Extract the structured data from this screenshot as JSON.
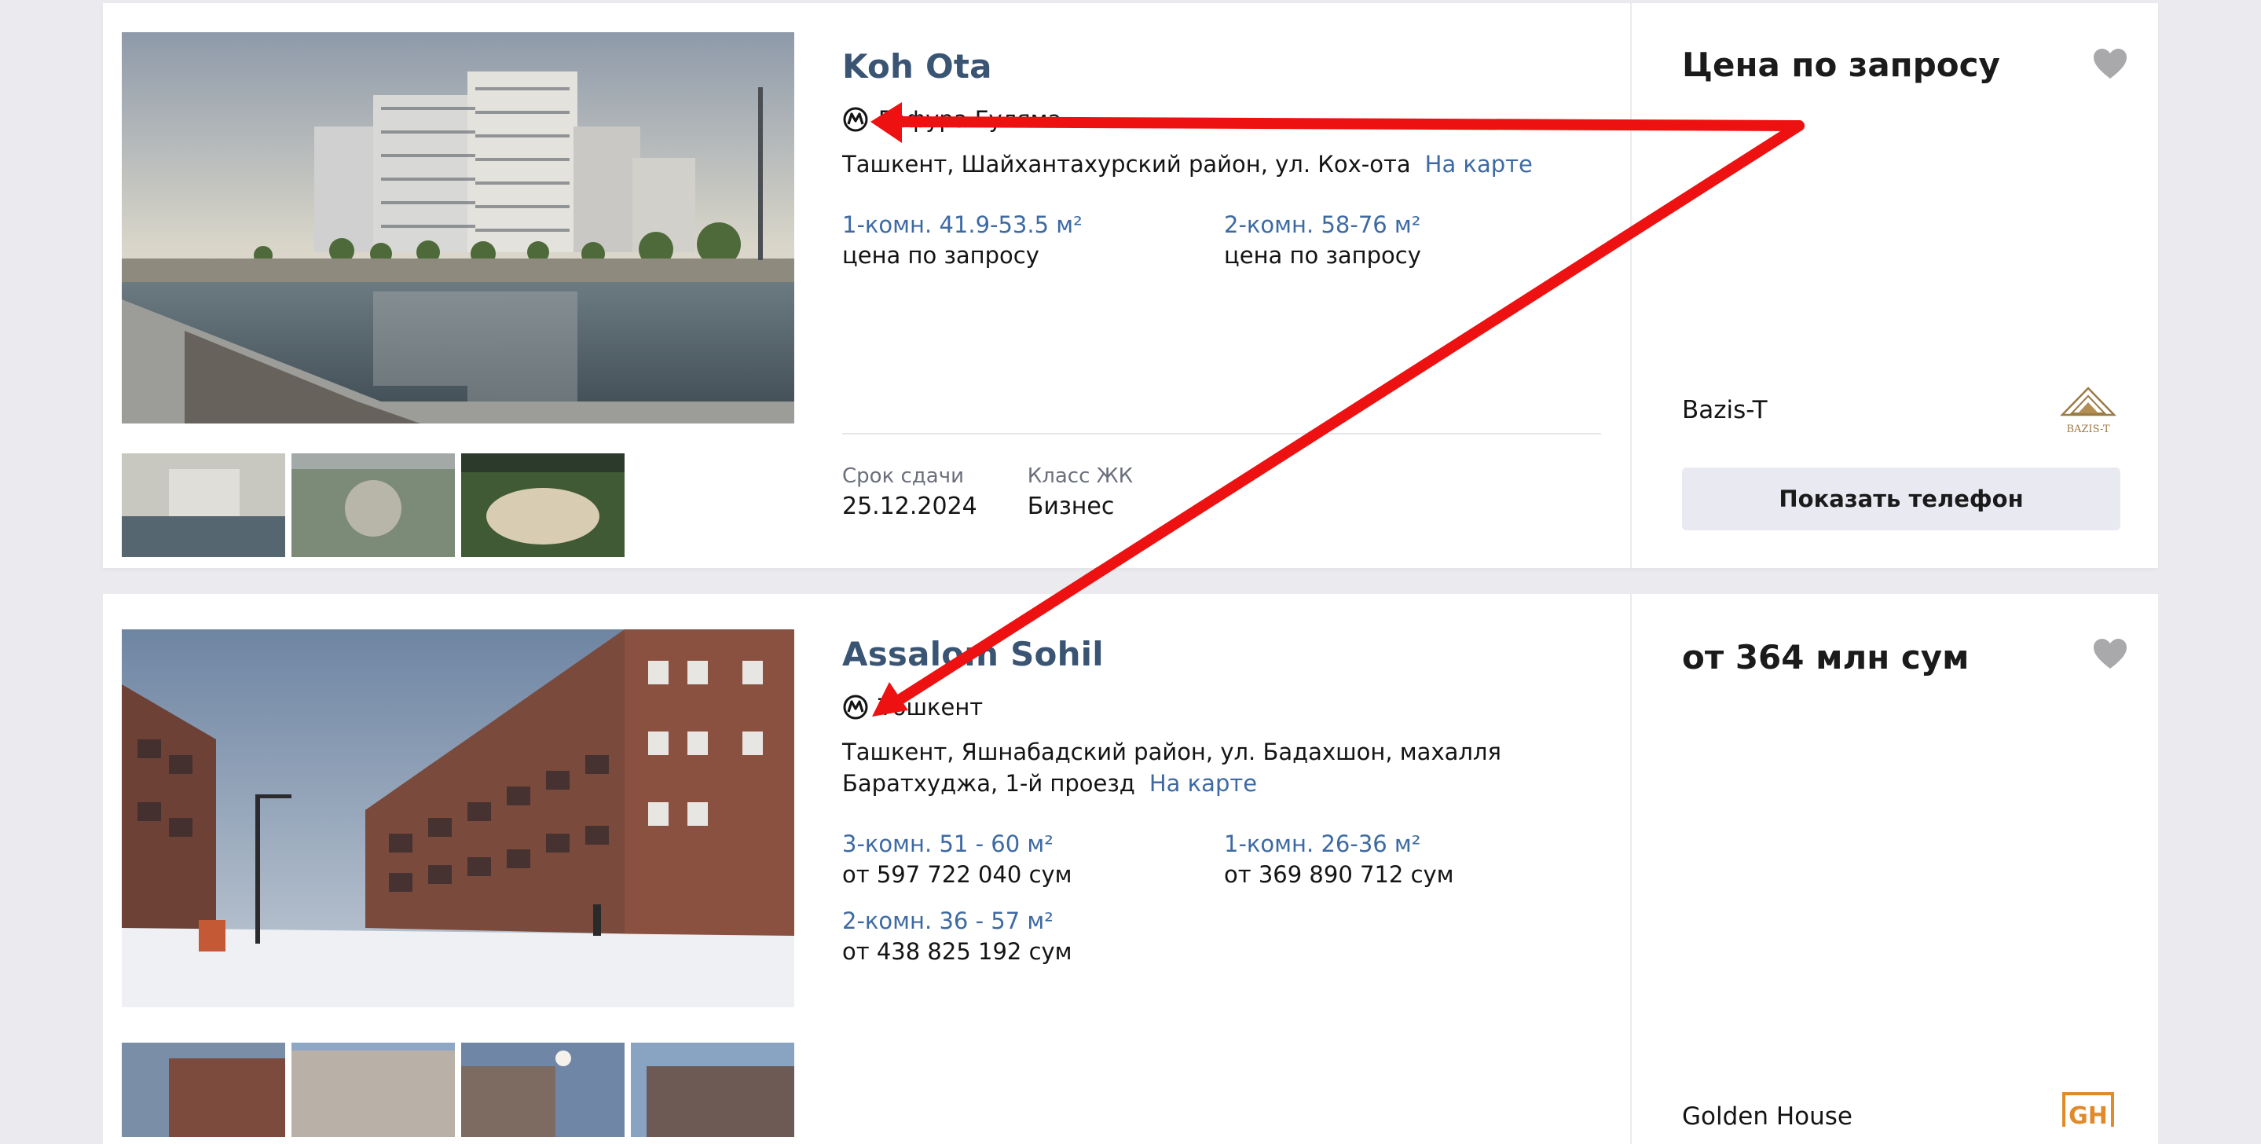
{
  "listings": [
    {
      "title": "Koh Ota",
      "metro": "Гафура Гуляма",
      "address": "Ташкент, Шайхантахурский район, ул. Кох-ота",
      "map_link": "На карте",
      "rooms": [
        {
          "type": "1-комн. 41.9-53.5 м²",
          "price": "цена по запросу"
        },
        {
          "type": "2-комн. 58-76 м²",
          "price": "цена по запросу"
        }
      ],
      "deadline_label": "Срок сдачи",
      "deadline_value": "25.12.2024",
      "class_label": "Класс ЖК",
      "class_value": "Бизнес",
      "price": "Цена по запросу",
      "developer": "Bazis-T",
      "developer_logo_text": "BAZIS-T",
      "phone_button": "Показать телефон"
    },
    {
      "title": "Assalom Sohil",
      "metro": "Тошкент",
      "address_line1": "Ташкент, Яшнабадский район, ул. Бадахшон, махалля",
      "address_line2": "Баратхуджа, 1-й проезд",
      "map_link": "На карте",
      "rooms": [
        {
          "type": "3-комн. 51 - 60 м²",
          "price": "от 597 722 040 сум"
        },
        {
          "type": "1-комн. 26-36 м²",
          "price": "от 369 890 712 сум"
        },
        {
          "type": "2-комн. 36 - 57 м²",
          "price": "от 438 825 192 сум"
        }
      ],
      "price": "от 364 млн сум",
      "developer": "Golden House",
      "developer_logo_text": "GH"
    }
  ],
  "colors": {
    "title": "#3a5474",
    "link": "#3d6aa3",
    "annotation_arrow": "#ee1111",
    "page_bg": "#ebebef"
  }
}
